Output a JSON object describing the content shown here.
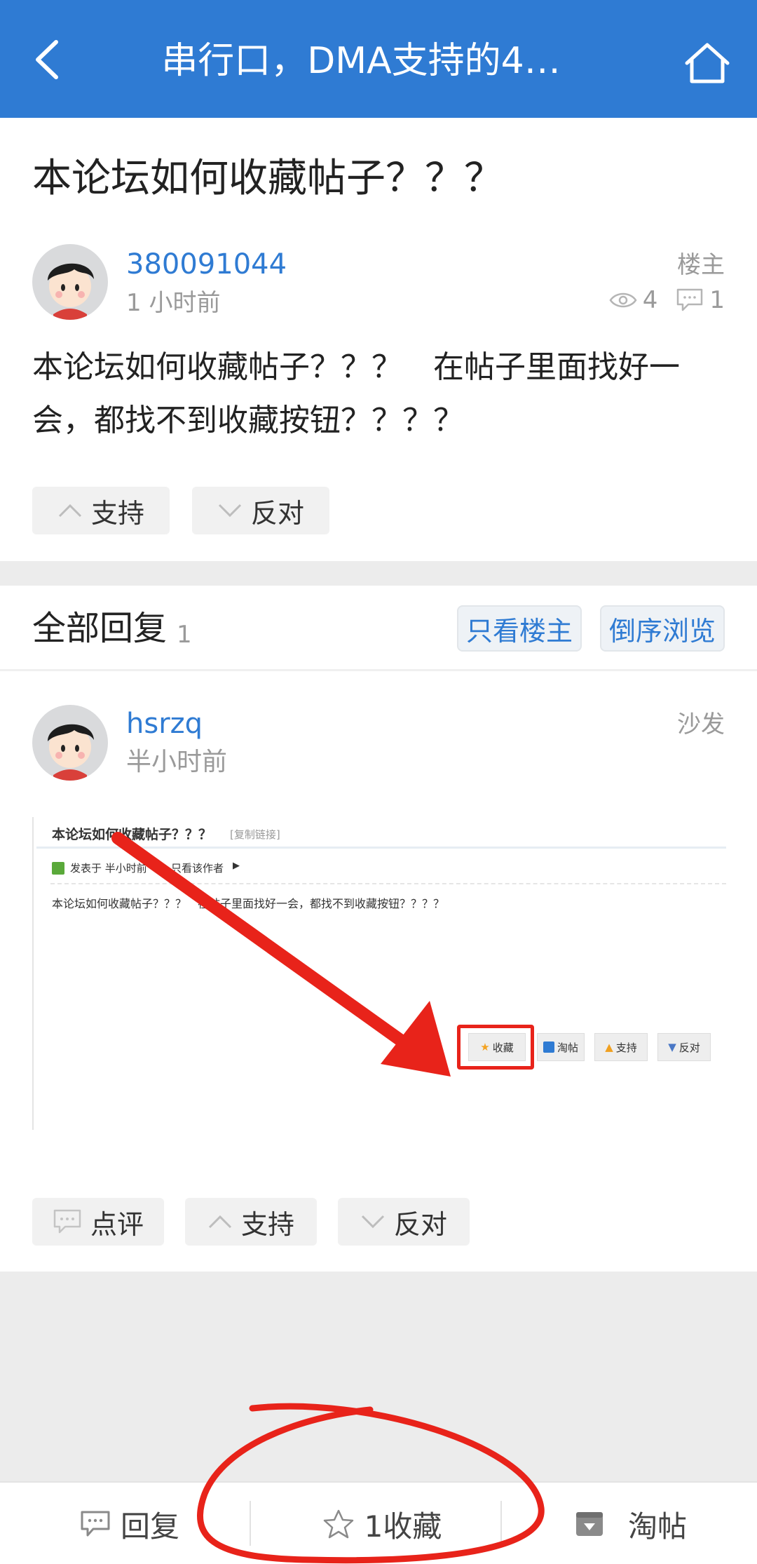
{
  "header": {
    "title": "串行口，DMA支持的4…"
  },
  "post": {
    "title": "本论坛如何收藏帖子？？？",
    "author": "380091044",
    "time": "1 小时前",
    "role": "楼主",
    "views": "4",
    "comments": "1",
    "body": "本论坛如何收藏帖子？？？　在帖子里面找好一会，都找不到收藏按钮？？？？",
    "support_label": "支持",
    "oppose_label": "反对"
  },
  "replies": {
    "title": "全部回复",
    "count": "1",
    "only_op_label": "只看楼主",
    "reverse_label": "倒序浏览",
    "items": [
      {
        "author": "hsrzq",
        "time": "半小时前",
        "floor": "沙发",
        "screenshot": {
          "title": "本论坛如何收藏帖子？？？",
          "copy_link": "[复制链接]",
          "posted": "发表于 半小时前",
          "only_author": "只看该作者",
          "body": "本论坛如何收藏帖子？？？　在帖子里面找好一会，都找不到收藏按钮？？？？",
          "btn_fav": "收藏",
          "btn_tao": "淘帖",
          "btn_support": "支持",
          "btn_oppose": "反对"
        },
        "comment_label": "点评",
        "support_label": "支持",
        "oppose_label": "反对"
      }
    ]
  },
  "bottom": {
    "reply_label": "回复",
    "fav_label": "1收藏",
    "tao_label": "淘帖"
  },
  "colors": {
    "brand": "#2f7bd3",
    "annotation_red": "#e8231a"
  }
}
